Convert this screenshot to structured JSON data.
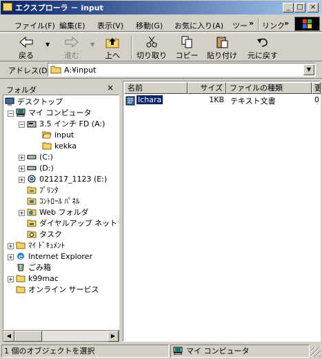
{
  "window": {
    "title": "エクスプローラ － input",
    "controls": {
      "minimize": "_",
      "maximize": "□",
      "close": "×"
    }
  },
  "menu": {
    "items": [
      "ファイル(F)",
      "編集(E)",
      "表示(V)",
      "移動(G)",
      "お気に入り(A)",
      "ツー"
    ],
    "overflow": "»",
    "links_label": "リンク",
    "links_overflow": "»"
  },
  "toolbar": {
    "back": "戻る",
    "forward": "進む",
    "up": "上へ",
    "cut": "切り取り",
    "copy": "コピー",
    "paste": "貼り付け",
    "undo": "元に戻す"
  },
  "address": {
    "label": "アドレス(D)",
    "value": "A:¥input"
  },
  "folder_pane": {
    "title": "フォルダ",
    "close": "×",
    "tree": [
      {
        "label": "デスクトップ",
        "icon": "desktop-icon"
      },
      {
        "label": "マイ コンピュータ",
        "icon": "computer-icon"
      },
      {
        "label": "3.5 インチ FD (A:)",
        "icon": "floppy-icon"
      },
      {
        "label": "input",
        "icon": "open-folder-icon"
      },
      {
        "label": "kekka",
        "icon": "folder-icon"
      },
      {
        "label": "(C:)",
        "icon": "drive-icon"
      },
      {
        "label": "(D:)",
        "icon": "drive-icon"
      },
      {
        "label": "021217_1123 (E:)",
        "icon": "cd-icon"
      },
      {
        "label": "ﾌﾟﾘﾝﾀ",
        "icon": "printer-folder-icon"
      },
      {
        "label": "ｺﾝﾄﾛｰﾙ ﾊﾟﾈﾙ",
        "icon": "control-panel-icon"
      },
      {
        "label": "Web フォルダ",
        "icon": "web-folder-icon"
      },
      {
        "label": "ダイヤルアップ ネットワー",
        "icon": "dialup-icon"
      },
      {
        "label": "タスク",
        "icon": "tasks-icon"
      },
      {
        "label": "ﾏｲ ﾄﾞｷｭﾒﾝﾄ",
        "icon": "documents-icon"
      },
      {
        "label": "Internet Explorer",
        "icon": "ie-icon"
      },
      {
        "label": "ごみ箱",
        "icon": "recycle-bin-icon"
      },
      {
        "label": "k99mac",
        "icon": "folder-icon"
      },
      {
        "label": "オンライン サービス",
        "icon": "folder-icon"
      }
    ]
  },
  "file_pane": {
    "columns": [
      "名前",
      "サイズ",
      "ファイルの種類",
      "更"
    ],
    "rows": [
      {
        "name": "Ichara",
        "size": "1KB",
        "type": "テキスト文書",
        "modified": "0"
      }
    ]
  },
  "status": {
    "selection": "1 個のオブジェクトを選択",
    "location": "マイ コンピュータ"
  }
}
